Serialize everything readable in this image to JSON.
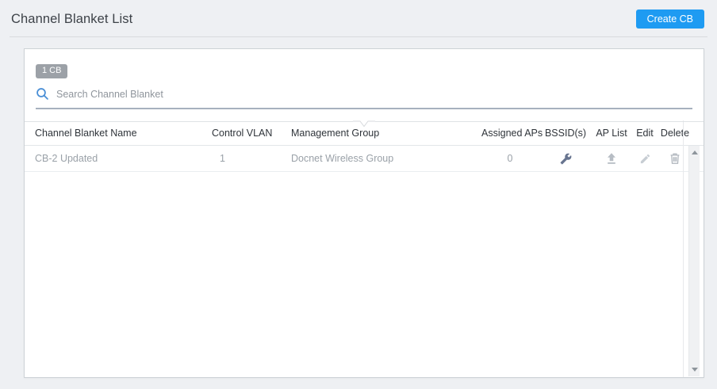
{
  "page": {
    "title": "Channel Blanket List",
    "create_button_label": "Create CB"
  },
  "panel": {
    "count_badge": "1 CB",
    "search_placeholder": "Search Channel Blanket",
    "search_icon": "search-icon",
    "collapse_icon": "chevron-down-notch-icon"
  },
  "table": {
    "columns": [
      "Channel Blanket Name",
      "Control VLAN",
      "Management Group",
      "Assigned APs",
      "BSSID(s)",
      "AP List",
      "Edit",
      "Delete"
    ],
    "rows": [
      {
        "name": "CB-2 Updated",
        "control_vlan": "1",
        "management_group": "Docnet Wireless Group",
        "assigned_aps": "0",
        "bssid_icon": "wrench-icon",
        "ap_list_icon": "upload-icon",
        "edit_icon": "pencil-icon",
        "delete_icon": "trash-icon"
      }
    ]
  },
  "colors": {
    "accent_blue": "#1e9bf2",
    "badge_gray": "#9ca1a7",
    "search_icon_blue": "#4a8fd6",
    "search_underline": "#a7b1be",
    "wrench_icon": "#67748f",
    "muted_icon_gray": "#b7bdc4",
    "edit_icon_gray": "#c7cdd3",
    "header_text": "#2f343a",
    "row_text": "#9aa1a8",
    "page_background": "#eef0f3"
  }
}
